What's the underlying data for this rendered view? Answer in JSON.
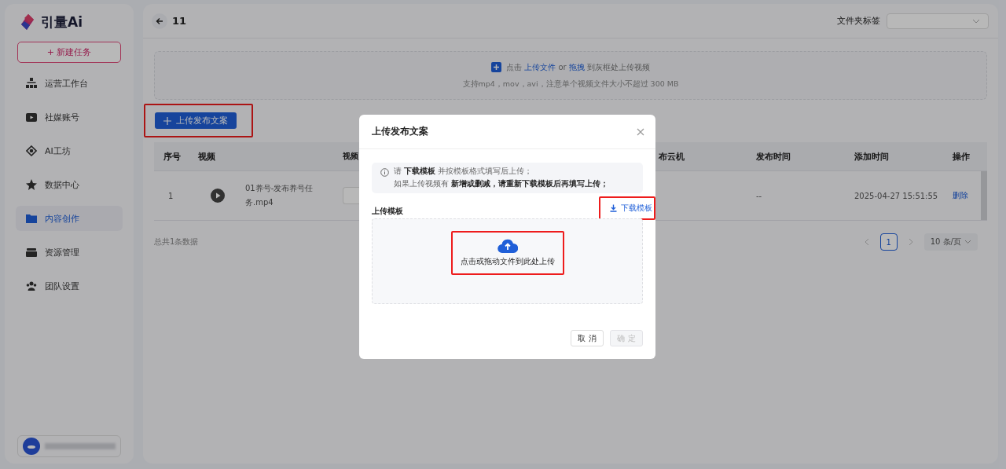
{
  "sidebar": {
    "logo": "引量Ai",
    "new_task_button": "+ 新建任务",
    "items": [
      {
        "label": "运营工作台",
        "selected": false
      },
      {
        "label": "社媒账号",
        "selected": false
      },
      {
        "label": "AI工坊",
        "selected": false
      },
      {
        "label": "数据中心",
        "selected": false
      },
      {
        "label": "内容创作",
        "selected": true
      },
      {
        "label": "资源管理",
        "selected": false
      },
      {
        "label": "团队设置",
        "selected": false
      }
    ]
  },
  "header": {
    "title": "11",
    "folder_tag_label": "文件夹标签"
  },
  "upload_zone": {
    "line": "点击 **上传文件** or **拖拽** 到灰框处上传视频",
    "hint": "支持mp4，mov，avi，注意单个视频文件大小不超过 300 MB"
  },
  "upload_copy_button": "上传发布文案",
  "table": {
    "columns": [
      "序号",
      "视频",
      "视频",
      "布云机",
      "发布时间",
      "添加时间",
      "操作"
    ],
    "rows": [
      {
        "index": "1",
        "file_name": "01养号-发布养号任务.mp4",
        "publish_time": "--",
        "added": "2025-04-27 15:51:55",
        "action": "删除"
      }
    ]
  },
  "footer": {
    "total": "总共1条数据",
    "pages": [
      {
        "label": "1",
        "selected": true
      }
    ],
    "page_size": "10 条/页"
  },
  "dialog": {
    "title": "上传发布文案",
    "notice": [
      "请 **下载模板** 并按模板格式填写后上传；",
      "如果上传视频有 **新增或删减，请重新下载模板后再填写上传；**"
    ],
    "template_label": "上传模板",
    "download_link": "下载模板",
    "drop_text": "点击或拖动文件到此处上传",
    "buttons": [
      {
        "label": "取 消",
        "disabled": false
      },
      {
        "label": "确 定",
        "disabled": true
      }
    ]
  }
}
